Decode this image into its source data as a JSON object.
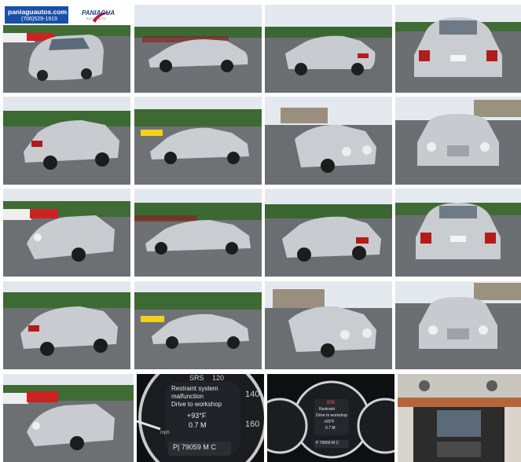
{
  "banner": {
    "site": "paniaguautos.com",
    "phone": "(706)529-1919",
    "brand": "PANIAGUA",
    "tagline": "AUTO SALES"
  },
  "cluster1": {
    "header": "SRS",
    "message1": "Restraint system",
    "message2": "malfunction",
    "message3": "Drive to workshop",
    "temp": "+93°F",
    "distance": "0.7 M",
    "odometer": "P| 79059 M C",
    "speed_140": "140",
    "speed_120": "120",
    "speed_160": "160",
    "unit": "mph"
  },
  "cluster2": {
    "line1": "808",
    "line2": "Restraint",
    "line3": "Drive to workshop",
    "line4": "+93°F",
    "line5": "0.7 M",
    "odometer": "P 79059 M C"
  },
  "colors": {
    "car": "#c9ccd0",
    "sky": "#dfe6ee",
    "trees": "#3e6a35",
    "asphalt": "#6a6d70",
    "banner_blue": "#1a4fa6"
  }
}
